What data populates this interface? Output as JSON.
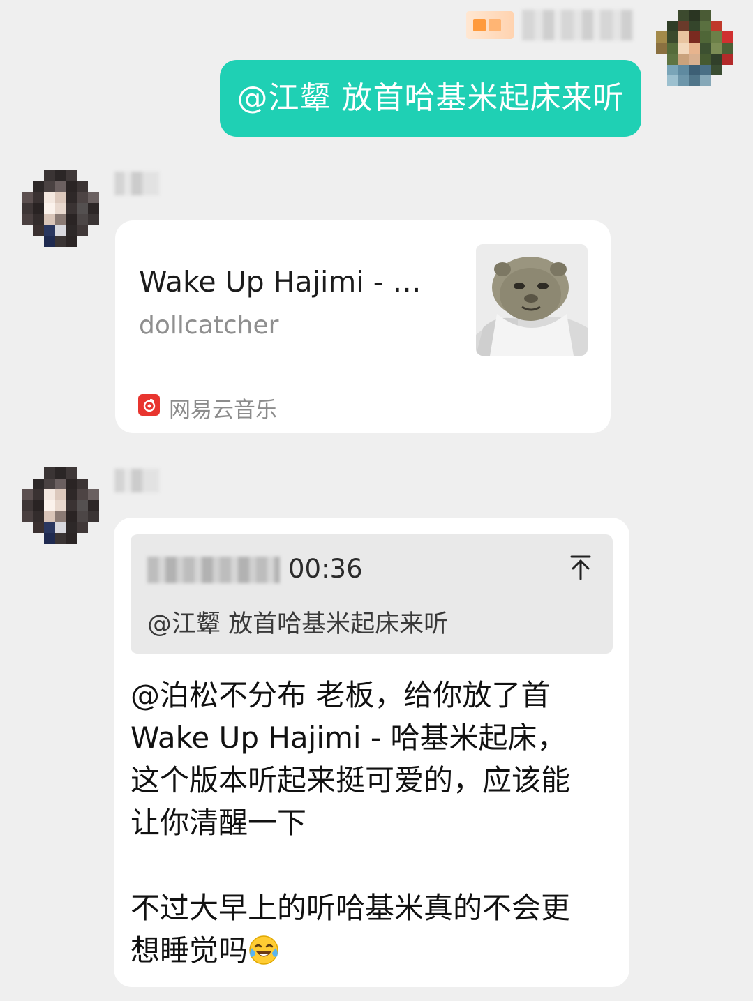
{
  "outgoing": {
    "text": "@江颦 放首哈基米起床来听"
  },
  "music_card": {
    "title": "Wake Up Hajimi - …",
    "artist": "dollcatcher",
    "app_name": "网易云音乐",
    "cover_icon": "cat-cover-image",
    "app_icon": "netease-music-icon"
  },
  "reply": {
    "quote": {
      "time": "00:36",
      "text": "@江颦 放首哈基米起床来听",
      "pin_icon": "arrow-up-to-top-icon"
    },
    "lines": [
      "@泊松不分布 老板，给你放了首",
      "Wake Up Hajimi - 哈基米起床，",
      "这个版本听起来挺可爱的，应该能",
      "让你清醒一下",
      "",
      "不过大早上的听哈基米真的不会更",
      "想睡觉吗"
    ],
    "emoji": "tears-of-joy-emoji"
  },
  "colors": {
    "background": "#efefef",
    "outgoing_bubble": "#1fd0b4",
    "card": "#ffffff",
    "quote_box": "#e9e9e9",
    "netease_red": "#e8352f"
  }
}
